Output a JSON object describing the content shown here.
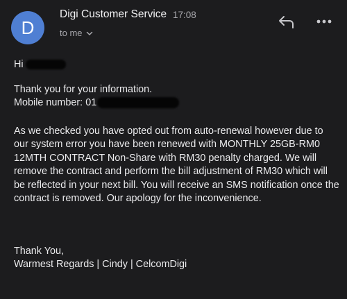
{
  "header": {
    "avatar_initial": "D",
    "sender": "Digi Customer Service",
    "time": "17:08",
    "recipient": "to me"
  },
  "icons": {
    "reply": "reply-arrow-icon",
    "more": "more-options-icon",
    "chevron": "chevron-down-icon"
  },
  "colors": {
    "avatar": "#4f7fd3",
    "background": "#1c1c1e",
    "text": "#ebebed",
    "muted": "#a9a9ae"
  },
  "email": {
    "greeting": "Hi",
    "thanks": "Thank you for your information.",
    "mobile_label": "Mobile number:",
    "mobile_visible_prefix": "01",
    "message": "As we checked you have opted out from auto-renewal however due to our system error you have been renewed with MONTHLY 25GB-RM0 12MTH CONTRACT Non-Share with RM30 penalty charged. We will remove the contract and perform the bill adjustment of RM30 which will be reflected in your next bill. You will receive an SMS notification once the contract is removed. Our apology for the inconvenience.",
    "closing": "Thank You,",
    "signature": "Warmest Regards | Cindy | CelcomDigi"
  }
}
